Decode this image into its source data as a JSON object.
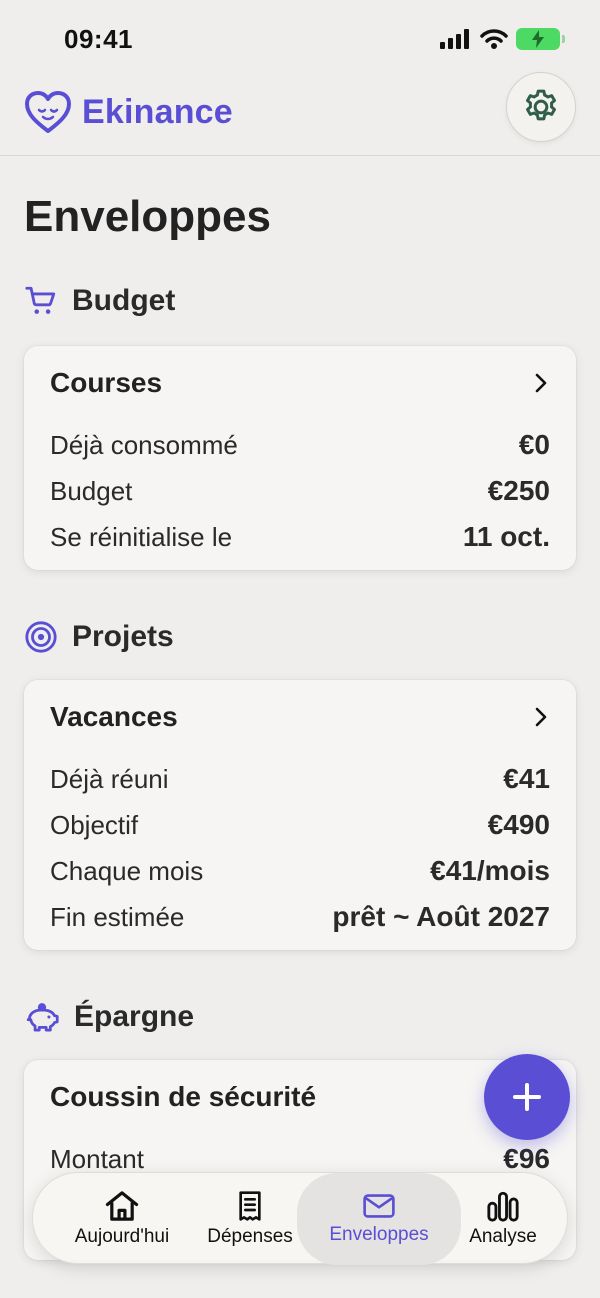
{
  "status": {
    "time": "09:41"
  },
  "brand": {
    "name": "Ekinance"
  },
  "page": {
    "title": "Enveloppes"
  },
  "sections": {
    "budget": {
      "title": "Budget",
      "card": {
        "title": "Courses",
        "rows": [
          {
            "label": "Déjà consommé",
            "value": "€0"
          },
          {
            "label": "Budget",
            "value": "€250"
          },
          {
            "label": "Se réinitialise le",
            "value": "11 oct."
          }
        ]
      }
    },
    "projets": {
      "title": "Projets",
      "card": {
        "title": "Vacances",
        "rows": [
          {
            "label": "Déjà réuni",
            "value": "€41"
          },
          {
            "label": "Objectif",
            "value": "€490"
          },
          {
            "label": "Chaque mois",
            "value": "€41/mois"
          },
          {
            "label": "Fin estimée",
            "value": "prêt ~ Août 2027"
          }
        ]
      }
    },
    "epargne": {
      "title": "Épargne",
      "card": {
        "title": "Coussin de sécurité",
        "rows": [
          {
            "label": "Montant",
            "value": "€96"
          }
        ]
      }
    }
  },
  "tabs": [
    {
      "label": "Aujourd'hui",
      "icon": "home-icon"
    },
    {
      "label": "Dépenses",
      "icon": "receipt-icon"
    },
    {
      "label": "Enveloppes",
      "icon": "envelope-icon",
      "active": true
    },
    {
      "label": "Analyse",
      "icon": "bar-chart-icon"
    }
  ],
  "colors": {
    "accent": "#5a4fd4",
    "background": "#efeeed",
    "card": "#f6f5f3",
    "battery": "#4cd964"
  }
}
